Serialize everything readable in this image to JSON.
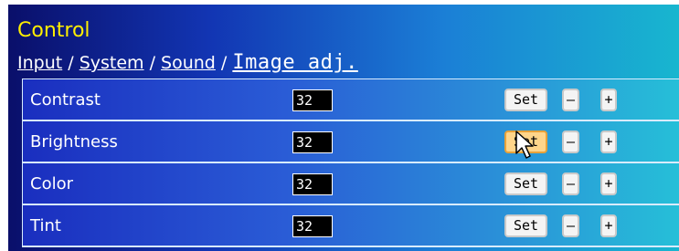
{
  "header": {
    "title": "Control",
    "breadcrumb": {
      "items": [
        "Input",
        "System",
        "Sound"
      ],
      "current": "Image adj.",
      "separator": " / "
    }
  },
  "rows": [
    {
      "label": "Contrast",
      "value": "32",
      "set_label": "Set",
      "minus_label": "–",
      "plus_label": "+"
    },
    {
      "label": "Brightness",
      "value": "32",
      "set_label": "Set",
      "minus_label": "–",
      "plus_label": "+"
    },
    {
      "label": "Color",
      "value": "32",
      "set_label": "Set",
      "minus_label": "–",
      "plus_label": "+"
    },
    {
      "label": "Tint",
      "value": "32",
      "set_label": "Set",
      "minus_label": "–",
      "plus_label": "+"
    }
  ],
  "colors": {
    "title": "#ffee00",
    "active_button": "#ffd58a"
  },
  "cursor": {
    "icon": "pointer-arrow-icon"
  }
}
